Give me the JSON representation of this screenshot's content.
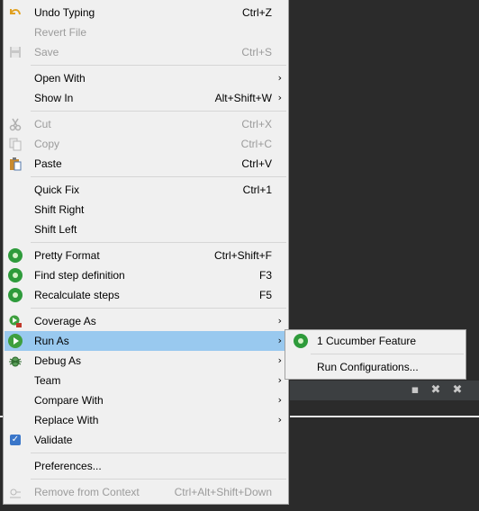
{
  "menu": {
    "items": [
      {
        "label": "Undo Typing",
        "accel": "Ctrl+Z",
        "icon": "undo-icon"
      },
      {
        "label": "Revert File",
        "accel": "",
        "icon": ""
      },
      {
        "label": "Save",
        "accel": "Ctrl+S",
        "icon": "save-icon"
      },
      {
        "label": "Open With",
        "accel": "",
        "icon": ""
      },
      {
        "label": "Show In",
        "accel": "Alt+Shift+W",
        "icon": ""
      },
      {
        "label": "Cut",
        "accel": "Ctrl+X",
        "icon": "cut-icon"
      },
      {
        "label": "Copy",
        "accel": "Ctrl+C",
        "icon": "copy-icon"
      },
      {
        "label": "Paste",
        "accel": "Ctrl+V",
        "icon": "paste-icon"
      },
      {
        "label": "Quick Fix",
        "accel": "Ctrl+1",
        "icon": ""
      },
      {
        "label": "Shift Right",
        "accel": "",
        "icon": ""
      },
      {
        "label": "Shift Left",
        "accel": "",
        "icon": ""
      },
      {
        "label": "Pretty Format",
        "accel": "Ctrl+Shift+F",
        "icon": "cucumber-icon"
      },
      {
        "label": "Find step definition",
        "accel": "F3",
        "icon": "cucumber-icon"
      },
      {
        "label": "Recalculate steps",
        "accel": "F5",
        "icon": "cucumber-icon"
      },
      {
        "label": "Coverage As",
        "accel": "",
        "icon": "coverage-icon"
      },
      {
        "label": "Run As",
        "accel": "",
        "icon": "run-icon"
      },
      {
        "label": "Debug As",
        "accel": "",
        "icon": "debug-bug-icon"
      },
      {
        "label": "Team",
        "accel": "",
        "icon": ""
      },
      {
        "label": "Compare With",
        "accel": "",
        "icon": ""
      },
      {
        "label": "Replace With",
        "accel": "",
        "icon": ""
      },
      {
        "label": "Validate",
        "accel": "",
        "icon": "checkbox-checked-icon"
      },
      {
        "label": "Preferences...",
        "accel": "",
        "icon": ""
      },
      {
        "label": "Remove from Context",
        "accel": "Ctrl+Alt+Shift+Down",
        "icon": "remove-context-icon"
      }
    ],
    "submenu_arrow": "›"
  },
  "submenu": {
    "items": [
      {
        "label": "1 Cucumber Feature",
        "icon": "cucumber-icon"
      },
      {
        "label": "Run Configurations...",
        "icon": ""
      }
    ]
  },
  "background_toolbar": {
    "icons": [
      "minimize-icon",
      "close-icon",
      "close-all-icon"
    ],
    "glyphs": [
      "▪",
      "✖",
      "✖"
    ]
  },
  "colors": {
    "highlight": "#99c9ef",
    "disabled_text": "#9b9b9b",
    "menu_bg": "#f0f0f0"
  }
}
